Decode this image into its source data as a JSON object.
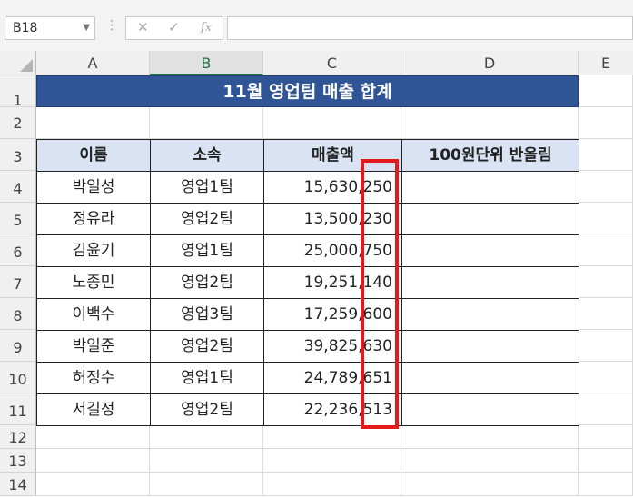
{
  "name_box": {
    "value": "B18"
  },
  "formula_bar": {
    "fx_label": "fx",
    "cancel_label": "✕",
    "confirm_label": "✓",
    "value": ""
  },
  "columns": [
    "A",
    "B",
    "C",
    "D",
    "E"
  ],
  "rows": [
    "1",
    "2",
    "3",
    "4",
    "5",
    "6",
    "7",
    "8",
    "9",
    "10",
    "11",
    "12",
    "13",
    "14"
  ],
  "sheet": {
    "title": "11월 영업팀 매출 합계",
    "headers": [
      "이름",
      "소속",
      "매출액",
      "100원단위 반올림"
    ],
    "data": [
      {
        "name": "박일성",
        "team": "영업1팀",
        "sales": "15,630,250",
        "rounded": ""
      },
      {
        "name": "정유라",
        "team": "영업2팀",
        "sales": "13,500,230",
        "rounded": ""
      },
      {
        "name": "김윤기",
        "team": "영업1팀",
        "sales": "25,000,750",
        "rounded": ""
      },
      {
        "name": "노종민",
        "team": "영업2팀",
        "sales": "19,251,140",
        "rounded": ""
      },
      {
        "name": "이백수",
        "team": "영업3팀",
        "sales": "17,259,600",
        "rounded": ""
      },
      {
        "name": "박일준",
        "team": "영업2팀",
        "sales": "39,825,630",
        "rounded": ""
      },
      {
        "name": "허정수",
        "team": "영업1팀",
        "sales": "24,789,651",
        "rounded": ""
      },
      {
        "name": "서길정",
        "team": "영업2팀",
        "sales": "22,236,513",
        "rounded": ""
      }
    ]
  },
  "colors": {
    "title_bg": "#2f5597",
    "header_bg": "#dae3f3",
    "highlight_border": "#e41a1a",
    "selected_col": "#217346"
  }
}
